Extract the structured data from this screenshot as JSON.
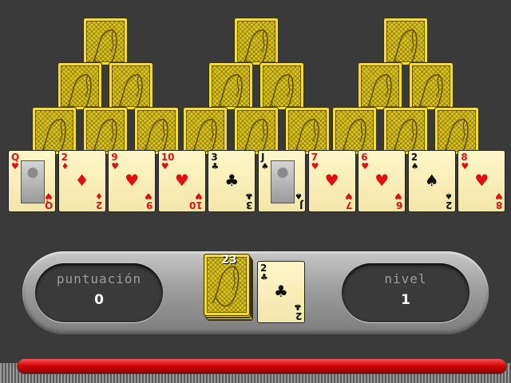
{
  "game": {
    "pyramids": [
      {
        "backs": 6
      },
      {
        "backs": 6
      },
      {
        "backs": 6
      }
    ],
    "row": [
      {
        "rank": "Q",
        "suit": "♥",
        "color": "red",
        "face": true
      },
      {
        "rank": "2",
        "suit": "♦",
        "color": "red"
      },
      {
        "rank": "9",
        "suit": "♥",
        "color": "red"
      },
      {
        "rank": "10",
        "suit": "♥",
        "color": "red"
      },
      {
        "rank": "3",
        "suit": "♣",
        "color": "black"
      },
      {
        "rank": "J",
        "suit": "♠",
        "color": "black",
        "face": true
      },
      {
        "rank": "7",
        "suit": "♥",
        "color": "red"
      },
      {
        "rank": "6",
        "suit": "♥",
        "color": "red"
      },
      {
        "rank": "2",
        "suit": "♠",
        "color": "black"
      },
      {
        "rank": "8",
        "suit": "♥",
        "color": "red"
      }
    ],
    "stock": {
      "count": "23"
    },
    "waste": {
      "rank": "2",
      "suit": "♣",
      "color": "black"
    }
  },
  "hud": {
    "score_label": "puntuación",
    "score_value": "0",
    "level_label": "nivel",
    "level_value": "1"
  },
  "colors": {
    "back": "#d8c21e",
    "face": "#fff6c8",
    "red": "#e01010",
    "bar": "#d20000"
  }
}
